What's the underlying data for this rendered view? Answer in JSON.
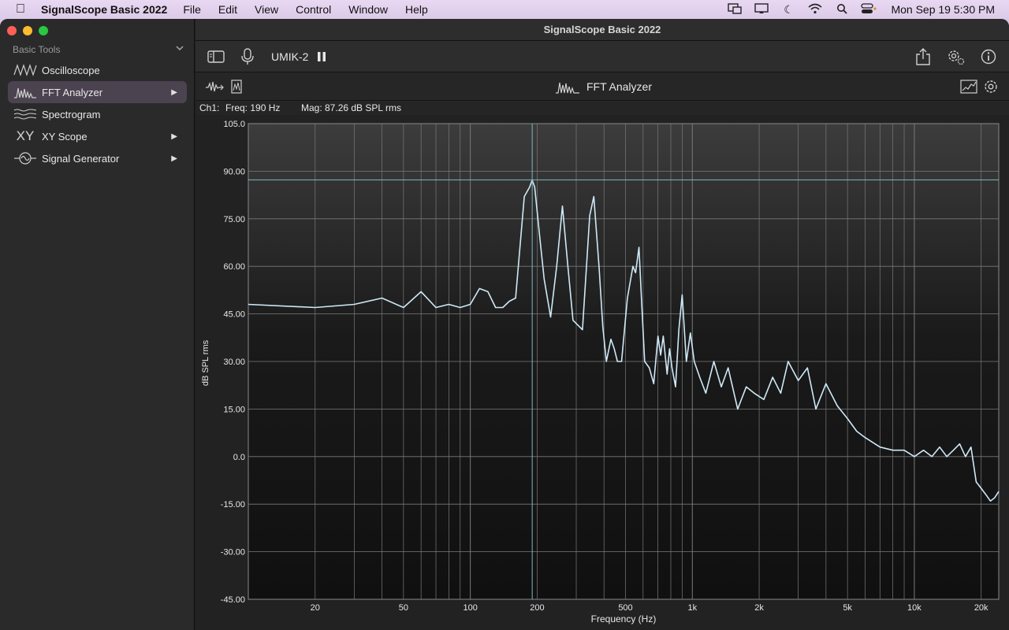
{
  "menubar": {
    "app_name": "SignalScope Basic 2022",
    "menus": [
      "File",
      "Edit",
      "View",
      "Control",
      "Window",
      "Help"
    ],
    "clock": "Mon Sep 19  5:30 PM"
  },
  "window": {
    "title": "SignalScope Basic 2022"
  },
  "sidebar": {
    "section_label": "Basic Tools",
    "items": [
      {
        "label": "Oscilloscope",
        "icon": "oscilloscope-icon",
        "selected": false,
        "has_arrow": false
      },
      {
        "label": "FFT Analyzer",
        "icon": "fft-icon",
        "selected": true,
        "has_arrow": true
      },
      {
        "label": "Spectrogram",
        "icon": "spectrogram-icon",
        "selected": false,
        "has_arrow": false
      },
      {
        "label": "XY Scope",
        "icon": "xy-icon",
        "selected": false,
        "has_arrow": true
      },
      {
        "label": "Signal Generator",
        "icon": "signal-generator-icon",
        "selected": false,
        "has_arrow": true
      }
    ],
    "xy_icon_text": "XY"
  },
  "toolbar": {
    "device": "UMIK-2"
  },
  "subbar": {
    "title": "FFT Analyzer"
  },
  "readout": {
    "channel": "Ch1:",
    "frequency": "Freq: 190 Hz",
    "magnitude": "Mag: 87.26 dB SPL rms"
  },
  "colors": {
    "trace": "#cfe9f7",
    "grid": "#7a7a7a",
    "cursor": "#7fb7bf",
    "selected_bg": "#4b4350"
  },
  "chart_data": {
    "type": "line",
    "xlabel": "Frequency (Hz)",
    "ylabel": "dB SPL rms",
    "x_scale": "log",
    "xlim": [
      10,
      24000
    ],
    "ylim": [
      -45,
      105
    ],
    "y_ticks": [
      "105.0",
      "90.00",
      "75.00",
      "60.00",
      "45.00",
      "30.00",
      "15.00",
      "0.0",
      "-15.00",
      "-30.00",
      "-45.00"
    ],
    "x_ticks": [
      {
        "value": 20,
        "label": "20"
      },
      {
        "value": 50,
        "label": "50"
      },
      {
        "value": 100,
        "label": "100"
      },
      {
        "value": 200,
        "label": "200"
      },
      {
        "value": 500,
        "label": "500"
      },
      {
        "value": 1000,
        "label": "1k"
      },
      {
        "value": 2000,
        "label": "2k"
      },
      {
        "value": 5000,
        "label": "5k"
      },
      {
        "value": 10000,
        "label": "10k"
      },
      {
        "value": 20000,
        "label": "20k"
      }
    ],
    "cursor": {
      "x": 190,
      "y": 87.26
    },
    "grid": true,
    "series": [
      {
        "x": [
          10,
          20,
          30,
          40,
          50,
          60,
          70,
          80,
          90,
          100,
          110,
          120,
          130,
          140,
          150,
          160,
          175,
          185,
          190,
          195,
          205,
          215,
          230,
          245,
          260,
          275,
          290,
          320,
          345,
          360,
          380,
          395,
          410,
          430,
          445,
          460,
          480,
          510,
          540,
          555,
          575,
          590,
          610,
          640,
          670,
          700,
          720,
          740,
          770,
          790,
          810,
          840,
          870,
          900,
          940,
          980,
          1020,
          1080,
          1150,
          1250,
          1350,
          1450,
          1600,
          1750,
          1900,
          2100,
          2300,
          2500,
          2700,
          3000,
          3300,
          3600,
          4000,
          4500,
          5000,
          5500,
          6000,
          7000,
          8000,
          9000,
          10000,
          11000,
          12000,
          13000,
          14000,
          15000,
          16000,
          17000,
          18000,
          19000,
          20000,
          21000,
          22000,
          23000,
          24000
        ],
        "y": [
          48,
          47,
          48,
          50,
          47,
          52,
          47,
          48,
          47,
          48,
          53,
          52,
          47,
          47,
          49,
          50,
          82,
          85,
          87.2,
          85,
          70,
          56,
          44,
          60,
          79,
          60,
          43,
          40,
          76,
          82,
          60,
          41,
          30,
          37,
          34,
          30,
          30,
          50,
          60,
          58,
          66,
          50,
          30,
          28,
          23,
          38,
          32,
          38,
          26,
          34,
          28,
          22,
          40,
          51,
          30,
          39,
          30,
          25,
          20,
          30,
          22,
          28,
          15,
          22,
          20,
          18,
          25,
          20,
          30,
          24,
          28,
          15,
          23,
          16,
          12,
          8,
          6,
          3,
          2,
          2,
          0,
          2,
          0,
          3,
          0,
          2,
          4,
          0,
          3,
          -8,
          -10,
          -12,
          -14,
          -13,
          -11
        ]
      }
    ]
  }
}
